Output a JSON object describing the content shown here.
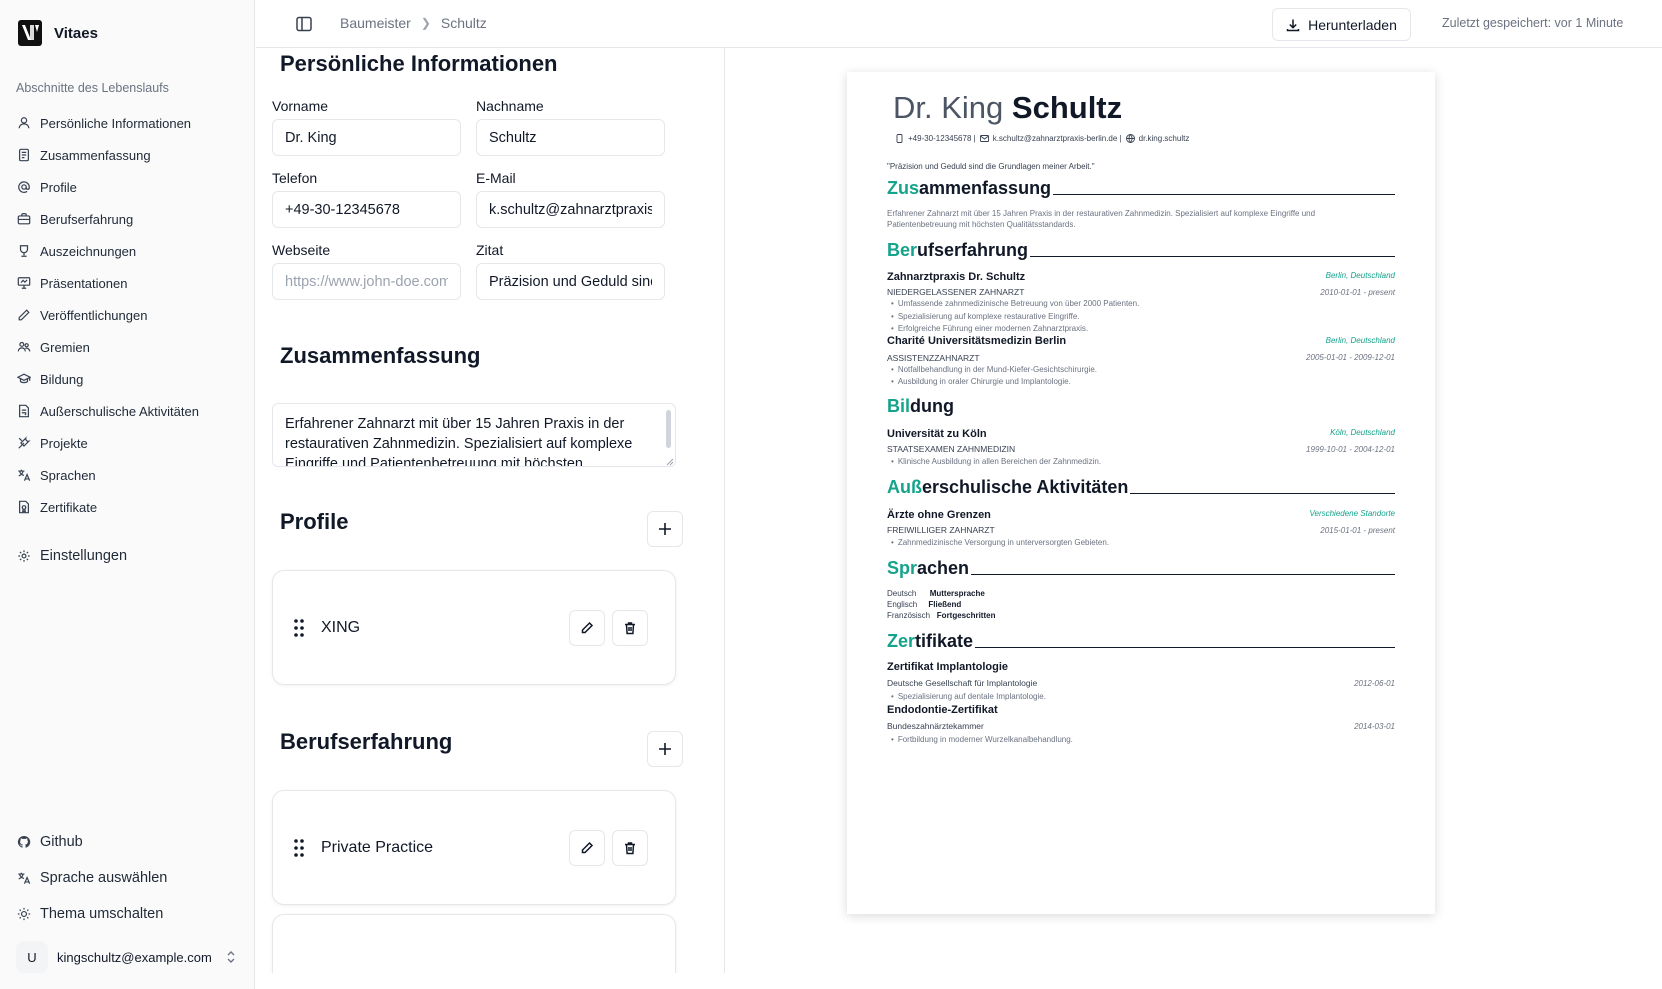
{
  "app": {
    "name": "Vitaes"
  },
  "sidebar": {
    "section_label": "Abschnitte des Lebenslaufs",
    "items": [
      {
        "label": "Persönliche Informationen",
        "icon": "user-icon"
      },
      {
        "label": "Zusammenfassung",
        "icon": "document-icon"
      },
      {
        "label": "Profile",
        "icon": "at-sign-icon"
      },
      {
        "label": "Berufserfahrung",
        "icon": "briefcase-icon"
      },
      {
        "label": "Auszeichnungen",
        "icon": "award-icon"
      },
      {
        "label": "Präsentationen",
        "icon": "presentation-icon"
      },
      {
        "label": "Veröffentlichungen",
        "icon": "pen-icon"
      },
      {
        "label": "Gremien",
        "icon": "users-icon"
      },
      {
        "label": "Bildung",
        "icon": "graduation-cap-icon"
      },
      {
        "label": "Außerschulische Aktivitäten",
        "icon": "activity-icon"
      },
      {
        "label": "Projekte",
        "icon": "tools-icon"
      },
      {
        "label": "Sprachen",
        "icon": "languages-icon"
      },
      {
        "label": "Zertifikate",
        "icon": "certificate-icon"
      }
    ],
    "settings_label": "Einstellungen",
    "bottom": {
      "github_label": "Github",
      "language_label": "Sprache auswählen",
      "theme_label": "Thema umschalten"
    },
    "user": {
      "avatar_initial": "U",
      "email": "kingschultz@example.com"
    }
  },
  "header": {
    "breadcrumb": [
      "Baumeister",
      "Schultz"
    ],
    "download_label": "Herunterladen",
    "saved_status": "Zuletzt gespeichert: vor 1 Minute"
  },
  "editor": {
    "personal": {
      "title": "Persönliche Informationen",
      "first_name_label": "Vorname",
      "first_name": "Dr. King",
      "last_name_label": "Nachname",
      "last_name": "Schultz",
      "phone_label": "Telefon",
      "phone": "+49-30-12345678",
      "email_label": "E-Mail",
      "email": "k.schultz@zahnarztpraxis-berlin.de",
      "website_label": "Webseite",
      "website": "",
      "website_placeholder": "https://www.john-doe.com",
      "quote_label": "Zitat",
      "quote": "Präzision und Geduld sind die Grundlagen meiner Arbeit."
    },
    "summary": {
      "title": "Zusammenfassung",
      "text": "Erfahrener Zahnarzt mit über 15 Jahren Praxis in der restaurativen Zahnmedizin. Spezialisiert auf komplexe Eingriffe und Patientenbetreuung mit höchsten Qualitätsstandards."
    },
    "profiles": {
      "title": "Profile",
      "items": [
        {
          "name": "XING"
        }
      ]
    },
    "experience": {
      "title": "Berufserfahrung",
      "items": [
        {
          "name": "Private Practice"
        }
      ]
    }
  },
  "resume": {
    "first_name": "Dr. King",
    "last_name": "Schultz",
    "contact": {
      "phone": "+49-30-12345678 |",
      "email": "k.schultz@zahnarztpraxis-berlin.de |",
      "website": "dr.king.schultz"
    },
    "quote": "\"Präzision und Geduld sind die Grundlagen meiner Arbeit.\"",
    "accent_color": "#14a38b",
    "summary": {
      "head": "Zus",
      "tail": "ammenfassung",
      "text": "Erfahrener Zahnarzt mit über 15 Jahren Praxis in der restaurativen Zahnmedizin. Spezialisiert auf komplexe Eingriffe und Patientenbetreuung mit höchsten Qualitätsstandards."
    },
    "experience": {
      "head": "Ber",
      "tail": "ufserfahrung",
      "entries": [
        {
          "org": "Zahnarztpraxis Dr. Schultz",
          "location": "Berlin, Deutschland",
          "role": "NIEDERGELASSENER ZAHNARZT",
          "dates": "2010-01-01 - present",
          "bullets": [
            "Umfassende zahnmedizinische Betreuung von über 2000 Patienten.",
            "Spezialisierung auf komplexe restaurative Eingriffe.",
            "Erfolgreiche Führung einer modernen Zahnarztpraxis."
          ]
        },
        {
          "org": "Charité Universitätsmedizin Berlin",
          "location": "Berlin, Deutschland",
          "role": "ASSISTENZZAHNARZT",
          "dates": "2005-01-01 - 2009-12-01",
          "bullets": [
            "Notfallbehandlung in der Mund-Kiefer-Gesichtschirurgie.",
            "Ausbildung in oraler Chirurgie und Implantologie."
          ]
        }
      ]
    },
    "education": {
      "head": "Bil",
      "tail": "dung",
      "org": "Universität zu Köln",
      "location": "Köln, Deutschland",
      "role": "STAATSEXAMEN ZAHNMEDIZIN",
      "dates": "1999-10-01 - 2004-12-01",
      "bullet": "Klinische Ausbildung in allen Bereichen der Zahnmedizin."
    },
    "activities": {
      "head": "Auß",
      "tail": "erschulische Aktivitäten",
      "org": "Ärzte ohne Grenzen",
      "location": "Verschiedene Standorte",
      "role": "FREIWILLIGER ZAHNARZT",
      "dates": "2015-01-01 - present",
      "bullet": "Zahnmedizinische Versorgung in unterversorgten Gebieten."
    },
    "languages": {
      "head": "Spr",
      "tail": "achen",
      "items": [
        {
          "name": "Deutsch",
          "level": "Muttersprache"
        },
        {
          "name": "Englisch",
          "level": "Fließend"
        },
        {
          "name": "Französisch",
          "level": "Fortgeschritten"
        }
      ]
    },
    "certificates": {
      "head": "Zer",
      "tail": "tifikate",
      "items": [
        {
          "name": "Zertifikat Implantologie",
          "issuer": "Deutsche Gesellschaft für Implantologie",
          "date": "2012-06-01",
          "bullet": "Spezialisierung auf dentale Implantologie."
        },
        {
          "name": "Endodontie-Zertifikat",
          "issuer": "Bundeszahnärztekammer",
          "date": "2014-03-01",
          "bullet": "Fortbildung in moderner Wurzelkanalbehandlung."
        }
      ]
    }
  }
}
